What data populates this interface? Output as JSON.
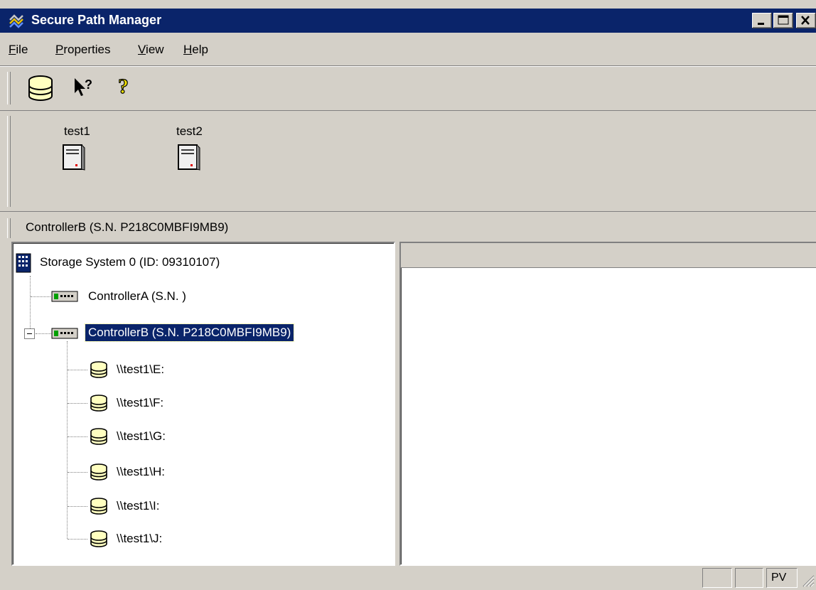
{
  "window": {
    "title": "Secure Path Manager",
    "accent_color": "#0a246a",
    "controls": [
      "minimize-icon",
      "maximize-icon",
      "close-icon"
    ]
  },
  "menu": {
    "items": [
      {
        "label": "File",
        "mnemonic": "F",
        "rest": "ile"
      },
      {
        "label": "Properties",
        "mnemonic": "P",
        "rest": "roperties"
      },
      {
        "label": "View",
        "mnemonic": "V",
        "rest": "iew"
      },
      {
        "label": "Help",
        "mnemonic": "H",
        "rest": "elp"
      }
    ]
  },
  "toolbar": {
    "buttons": [
      "storage-system-icon",
      "context-help-icon",
      "help-icon"
    ]
  },
  "hosts": [
    {
      "name": "test1",
      "icon": "server-icon"
    },
    {
      "name": "test2",
      "icon": "server-icon"
    }
  ],
  "path_label": "ControllerB (S.N. P218C0MBFI9MB9)",
  "tree": {
    "root": {
      "label": "Storage System 0   (ID: 09310107)",
      "icon": "storage-array-icon"
    },
    "controllers": [
      {
        "label": "ControllerA (S.N. )",
        "icon": "controller-icon",
        "expanded": false
      },
      {
        "label": "ControllerB (S.N. P218C0MBFI9MB9)",
        "icon": "controller-icon",
        "expanded": true,
        "selected": true
      }
    ],
    "drives": [
      {
        "label": "\\\\test1\\E:",
        "icon": "disk-icon"
      },
      {
        "label": "\\\\test1\\F:",
        "icon": "disk-icon"
      },
      {
        "label": "\\\\test1\\G:",
        "icon": "disk-icon"
      },
      {
        "label": "\\\\test1\\H:",
        "icon": "disk-icon"
      },
      {
        "label": "\\\\test1\\I:",
        "icon": "disk-icon"
      },
      {
        "label": "\\\\test1\\J:",
        "icon": "disk-icon"
      }
    ]
  },
  "status": {
    "cells": [
      "",
      "",
      "PV"
    ]
  }
}
